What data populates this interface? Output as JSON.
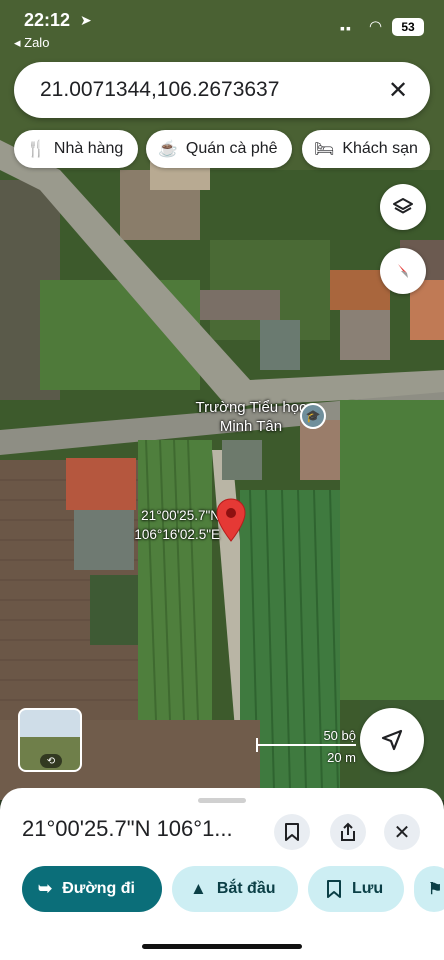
{
  "status_bar": {
    "time": "22:12",
    "back_app": "◂ Zalo",
    "battery": "53"
  },
  "search": {
    "query": "21.0071344,106.2673637"
  },
  "categories": [
    {
      "label": "Nhà hàng",
      "icon": "restaurant-icon"
    },
    {
      "label": "Quán cà phê",
      "icon": "cafe-icon"
    },
    {
      "label": "Khách sạn",
      "icon": "hotel-icon"
    }
  ],
  "map": {
    "school_label": "Trường Tiểu học Minh Tân",
    "pin_lat": "21°00'25.7\"N",
    "pin_lng": "106°16'02.5\"E",
    "scale_top": "50 bộ",
    "scale_bottom": "20 m",
    "pin_color": "#e53935"
  },
  "sheet": {
    "title": "21°00'25.7\"N 106°1...",
    "actions": {
      "directions": "Đường đi",
      "start": "Bắt đầu",
      "save": "Lưu"
    },
    "accent": "#0b6e79"
  }
}
